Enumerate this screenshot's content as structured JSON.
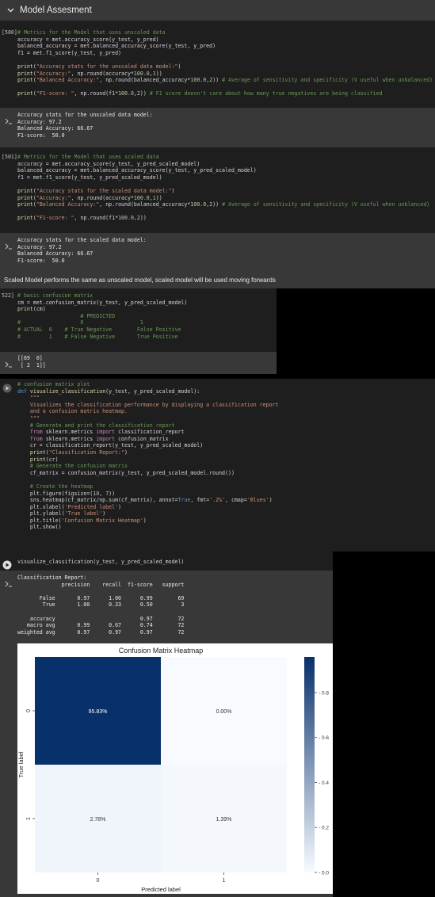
{
  "section": {
    "title": "Model Assesment"
  },
  "cell500": {
    "prompt": "[500]",
    "lines": [
      [
        [
          "c-com",
          "# Metrics for the Model that uses unscaled data"
        ]
      ],
      [
        [
          "c-pl",
          "accuracy = met.accuracy_score(y_test, y_pred)"
        ]
      ],
      [
        [
          "c-pl",
          "balanced_accuracy = met.balanced_accuracy_score(y_test, y_pred)"
        ]
      ],
      [
        [
          "c-pl",
          "f1 = met.f1_score(y_test, y_pred)"
        ]
      ],
      [],
      [
        [
          "c-fn",
          "print"
        ],
        [
          "c-pl",
          "("
        ],
        [
          "c-str",
          "\"Accuracy stats for the unscaled data model:\""
        ],
        [
          "c-pl",
          ")"
        ]
      ],
      [
        [
          "c-fn",
          "print"
        ],
        [
          "c-pl",
          "("
        ],
        [
          "c-str",
          "\"Accuracy:\""
        ],
        [
          "c-pl",
          ", np.round(accuracy*"
        ],
        [
          "c-num",
          "100.0"
        ],
        [
          "c-pl",
          ","
        ],
        [
          "c-num",
          "1"
        ],
        [
          "c-pl",
          "))"
        ]
      ],
      [
        [
          "c-fn",
          "print"
        ],
        [
          "c-pl",
          "("
        ],
        [
          "c-str",
          "\"Balanced Accuracy:\""
        ],
        [
          "c-pl",
          ", np.round(balanced_accuracy*"
        ],
        [
          "c-num",
          "100.0"
        ],
        [
          "c-pl",
          ","
        ],
        [
          "c-num",
          "2"
        ],
        [
          "c-pl",
          "))"
        ],
        [
          "c-com",
          " # Average of sensitivity and specificity (V useful when unbalanced)"
        ]
      ],
      [],
      [
        [
          "c-fn",
          "print"
        ],
        [
          "c-pl",
          "("
        ],
        [
          "c-str",
          "\"F1-score: \""
        ],
        [
          "c-pl",
          ", np.round(f1*"
        ],
        [
          "c-num",
          "100.0"
        ],
        [
          "c-pl",
          ","
        ],
        [
          "c-num",
          "2"
        ],
        [
          "c-pl",
          "))"
        ],
        [
          "c-com",
          " # F1 score doesn't care about how many true negatives are being classified"
        ]
      ]
    ],
    "output": [
      "Accuracy stats for the unscaled data model:",
      "Accuracy: 97.2",
      "Balanced Accuracy: 66.67",
      "F1-score:  50.0"
    ]
  },
  "cell501": {
    "prompt": "[501]",
    "lines": [
      [
        [
          "c-com",
          "# Metrics for the Model that uses scaled data"
        ]
      ],
      [
        [
          "c-pl",
          "accuracy = met.accuracy_score(y_test, y_pred_scaled_model)"
        ]
      ],
      [
        [
          "c-pl",
          "balanced_accuracy = met.balanced_accuracy_score(y_test, y_pred_scaled_model)"
        ]
      ],
      [
        [
          "c-pl",
          "f1 = met.f1_score(y_test, y_pred_scaled_model)"
        ]
      ],
      [],
      [
        [
          "c-fn",
          "print"
        ],
        [
          "c-pl",
          "("
        ],
        [
          "c-str",
          "\"Accuracy stats for the scaled data model:\""
        ],
        [
          "c-pl",
          ")"
        ]
      ],
      [
        [
          "c-fn",
          "print"
        ],
        [
          "c-pl",
          "("
        ],
        [
          "c-str",
          "\"Accuracy:\""
        ],
        [
          "c-pl",
          ", np.round(accuracy*"
        ],
        [
          "c-num",
          "100.0"
        ],
        [
          "c-pl",
          ","
        ],
        [
          "c-num",
          "1"
        ],
        [
          "c-pl",
          "))"
        ]
      ],
      [
        [
          "c-fn",
          "print"
        ],
        [
          "c-pl",
          "("
        ],
        [
          "c-str",
          "\"Balanced Accuracy:\""
        ],
        [
          "c-pl",
          ", np.round(balanced_accuracy*"
        ],
        [
          "c-num",
          "100.0"
        ],
        [
          "c-pl",
          ","
        ],
        [
          "c-num",
          "2"
        ],
        [
          "c-pl",
          "))"
        ],
        [
          "c-com",
          " # Average of sensitivity and specificity (V useful when unblanced)"
        ]
      ],
      [],
      [
        [
          "c-fn",
          "print"
        ],
        [
          "c-pl",
          "("
        ],
        [
          "c-str",
          "\"F1-score: \""
        ],
        [
          "c-pl",
          ", np.round(f1*"
        ],
        [
          "c-num",
          "100.0"
        ],
        [
          "c-pl",
          ","
        ],
        [
          "c-num",
          "2"
        ],
        [
          "c-pl",
          "))"
        ]
      ]
    ],
    "output": [
      "Accuracy stats for the scaled data model:",
      "Accuracy: 97.2",
      "Balanced Accuracy: 66.67",
      "F1-score:  50.0"
    ]
  },
  "markdown": {
    "text": "Scaled Model performs the same as unscaled model, scaled model will be used moving forwards"
  },
  "cell522": {
    "prompt": "522]",
    "lines": [
      [
        [
          "c-com",
          "# basic confusion matrix"
        ]
      ],
      [
        [
          "c-pl",
          "cm = met.confusion_matrix(y_test, y_pred_scaled_model)"
        ]
      ],
      [
        [
          "c-fn",
          "print"
        ],
        [
          "c-pl",
          "(cm)"
        ]
      ],
      [
        [
          "c-com",
          "                    # PREDICTED"
        ]
      ],
      [
        [
          "c-com",
          "#                   0                  1"
        ]
      ],
      [
        [
          "c-com",
          "# ACTUAL  0    # True Negative        False Positive"
        ]
      ],
      [
        [
          "c-com",
          "#         1    # False Negative       True Positive"
        ]
      ]
    ],
    "output": [
      "[[69  0]",
      " [ 2  1]]"
    ]
  },
  "cellViz": {
    "lines": [
      [
        [
          "c-com",
          "# confusion matrix plot"
        ]
      ],
      [
        [
          "c-def",
          "def "
        ],
        [
          "c-fn",
          "visualize_classification"
        ],
        [
          "c-pl",
          "(y_test, y_pred_scaled_model):"
        ]
      ],
      [
        [
          "c-doc",
          "    \"\"\""
        ]
      ],
      [
        [
          "c-doc",
          "    Visualizes the classification performance by displaying a classification report"
        ]
      ],
      [
        [
          "c-doc",
          "    and a confusion matrix heatmap."
        ]
      ],
      [
        [
          "c-doc",
          "    \"\"\""
        ]
      ],
      [
        [
          "c-com",
          "    # Generate and print the classification report"
        ]
      ],
      [
        [
          "c-kw",
          "    from "
        ],
        [
          "c-pl",
          "sklearn.metrics "
        ],
        [
          "c-kw",
          "import "
        ],
        [
          "c-pl",
          "classification_report"
        ]
      ],
      [
        [
          "c-kw",
          "    from "
        ],
        [
          "c-pl",
          "sklearn.metrics "
        ],
        [
          "c-kw",
          "import "
        ],
        [
          "c-pl",
          "confusion_matrix"
        ]
      ],
      [
        [
          "c-pl",
          "    cr = classification_report(y_test, y_pred_scaled_model)"
        ]
      ],
      [
        [
          "c-fn",
          "    print"
        ],
        [
          "c-pl",
          "("
        ],
        [
          "c-str",
          "\"Classification Report:\""
        ],
        [
          "c-pl",
          ")"
        ]
      ],
      [
        [
          "c-fn",
          "    print"
        ],
        [
          "c-pl",
          "(cr)"
        ]
      ],
      [
        [
          "c-com",
          "    # Generate the confusion matrix"
        ]
      ],
      [
        [
          "c-pl",
          "    cf_matrix = confusion_matrix(y_test, y_pred_scaled_model.round())"
        ]
      ],
      [],
      [
        [
          "c-com",
          "    # Create the heatmap"
        ]
      ],
      [
        [
          "c-pl",
          "    plt.figure(figsize=("
        ],
        [
          "c-num",
          "10"
        ],
        [
          "c-pl",
          ", "
        ],
        [
          "c-num",
          "7"
        ],
        [
          "c-pl",
          "))"
        ]
      ],
      [
        [
          "c-pl",
          "    sns.heatmap(cf_matrix/np.sum(cf_matrix), annot="
        ],
        [
          "c-def",
          "True"
        ],
        [
          "c-pl",
          ", fmt="
        ],
        [
          "c-str",
          "'.2%'"
        ],
        [
          "c-pl",
          ", cmap="
        ],
        [
          "c-str",
          "'Blues'"
        ],
        [
          "c-pl",
          ")"
        ]
      ],
      [
        [
          "c-pl",
          "    plt.xlabel("
        ],
        [
          "c-str",
          "'Predicted label'"
        ],
        [
          "c-pl",
          ")"
        ]
      ],
      [
        [
          "c-pl",
          "    plt.ylabel("
        ],
        [
          "c-str",
          "'True label'"
        ],
        [
          "c-pl",
          ")"
        ]
      ],
      [
        [
          "c-pl",
          "    plt.title("
        ],
        [
          "c-str",
          "'Confusion Matrix Heatmap'"
        ],
        [
          "c-pl",
          ")"
        ]
      ],
      [
        [
          "c-pl",
          "    plt.show()"
        ]
      ]
    ]
  },
  "cellRun": {
    "code": "visualize_classification(y_test, y_pred_scaled_model)",
    "report": [
      "Classification Report:",
      "              precision    recall  f1-score   support",
      "",
      "       False       0.97      1.00      0.99        69",
      "        True       1.00      0.33      0.50         3",
      "",
      "    accuracy                           0.97        72",
      "   macro avg       0.99      0.67      0.74        72",
      "weighted avg       0.97      0.97      0.97        72"
    ]
  },
  "chart_data": {
    "type": "heatmap",
    "title": "Confusion Matrix Heatmap",
    "xlabel": "Predicted label",
    "ylabel": "True label",
    "x_categories": [
      "0",
      "1"
    ],
    "y_categories": [
      "0",
      "1"
    ],
    "values": [
      [
        0.9583,
        0.0
      ],
      [
        0.0278,
        0.0139
      ]
    ],
    "annotations": [
      [
        "95.83%",
        "0.00%"
      ],
      [
        "2.78%",
        "1.39%"
      ]
    ],
    "colorbar": {
      "range": [
        0.0,
        0.9583
      ],
      "ticks": [
        "0.0",
        "0.2",
        "0.4",
        "0.6",
        "0.8"
      ],
      "tick_values": [
        0.0,
        0.2,
        0.4,
        0.6,
        0.8
      ],
      "cmap": "Blues"
    },
    "colors": {
      "low": "#f7fbff",
      "high": "#08306b"
    }
  }
}
